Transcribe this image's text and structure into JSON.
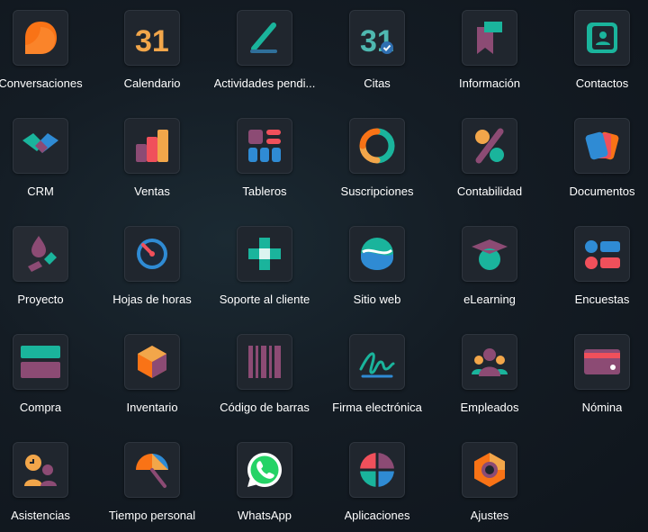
{
  "apps": [
    {
      "id": "conversaciones",
      "label": "Conversaciones",
      "icon": "chat-bubble-icon"
    },
    {
      "id": "calendario",
      "label": "Calendario",
      "icon": "calendar-icon",
      "icon_text": "31"
    },
    {
      "id": "actividades",
      "label": "Actividades pendi...",
      "icon": "pencil-slash-icon"
    },
    {
      "id": "citas",
      "label": "Citas",
      "icon": "calendar-check-icon",
      "icon_text": "31"
    },
    {
      "id": "informacion",
      "label": "Información",
      "icon": "bookmark-icon"
    },
    {
      "id": "contactos",
      "label": "Contactos",
      "icon": "contact-card-icon"
    },
    {
      "id": "crm",
      "label": "CRM",
      "icon": "handshake-icon"
    },
    {
      "id": "ventas",
      "label": "Ventas",
      "icon": "bar-chart-icon"
    },
    {
      "id": "tableros",
      "label": "Tableros",
      "icon": "dashboard-icon"
    },
    {
      "id": "suscripciones",
      "label": "Suscripciones",
      "icon": "cycle-icon"
    },
    {
      "id": "contabilidad",
      "label": "Contabilidad",
      "icon": "percent-icon"
    },
    {
      "id": "documentos",
      "label": "Documentos",
      "icon": "documents-icon"
    },
    {
      "id": "proyecto",
      "label": "Proyecto",
      "icon": "project-drop-icon"
    },
    {
      "id": "hojas_horas",
      "label": "Hojas de horas",
      "icon": "stopwatch-icon"
    },
    {
      "id": "soporte",
      "label": "Soporte al cliente",
      "icon": "support-cross-icon"
    },
    {
      "id": "sitio_web",
      "label": "Sitio web",
      "icon": "globe-wave-icon"
    },
    {
      "id": "elearning",
      "label": "eLearning",
      "icon": "graduation-cap-icon"
    },
    {
      "id": "encuestas",
      "label": "Encuestas",
      "icon": "survey-icon"
    },
    {
      "id": "compra",
      "label": "Compra",
      "icon": "credit-card-icon"
    },
    {
      "id": "inventario",
      "label": "Inventario",
      "icon": "box-cube-icon"
    },
    {
      "id": "codigo_barras",
      "label": "Código de barras",
      "icon": "barcode-icon"
    },
    {
      "id": "firma",
      "label": "Firma electrónica",
      "icon": "signature-icon"
    },
    {
      "id": "empleados",
      "label": "Empleados",
      "icon": "people-icon"
    },
    {
      "id": "nomina",
      "label": "Nómina",
      "icon": "payroll-card-icon"
    },
    {
      "id": "asistencias",
      "label": "Asistencias",
      "icon": "attendance-icon"
    },
    {
      "id": "tiempo_personal",
      "label": "Tiempo personal",
      "icon": "umbrella-icon"
    },
    {
      "id": "whatsapp",
      "label": "WhatsApp",
      "icon": "whatsapp-icon"
    },
    {
      "id": "aplicaciones",
      "label": "Aplicaciones",
      "icon": "apps-quadrant-icon"
    },
    {
      "id": "ajustes",
      "label": "Ajustes",
      "icon": "gear-hexagon-icon"
    }
  ],
  "colors": {
    "tile_bg": "#20262e",
    "label": "#ffffff",
    "orange": "#f97316",
    "teal": "#1ab49c",
    "purple": "#8c4b74",
    "blue": "#2f8bd4",
    "red": "#f0505b",
    "yellow": "#f7c948",
    "whatsapp_green": "#25d366"
  }
}
